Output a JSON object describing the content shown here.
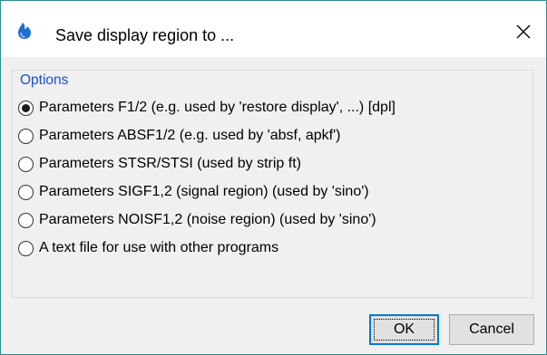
{
  "dialog": {
    "title": "Save display region to ...",
    "close_glyph": "✕",
    "icons": {
      "app": "topspin-drop-icon",
      "close": "close-icon"
    }
  },
  "options_group": {
    "title": "Options",
    "selected_index": 0,
    "items": [
      {
        "label": "Parameters F1/2 (e.g. used by 'restore display', ...) [dpl]"
      },
      {
        "label": "Parameters ABSF1/2 (e.g. used by 'absf, apkf')"
      },
      {
        "label": "Parameters STSR/STSI (used by strip ft)"
      },
      {
        "label": "Parameters SIGF1,2 (signal region) (used by 'sino')"
      },
      {
        "label": "Parameters NOISF1,2 (noise region) (used by 'sino')"
      },
      {
        "label": "A text file for use with other programs"
      }
    ]
  },
  "buttons": {
    "ok": {
      "accel": "O",
      "rest": "K"
    },
    "cancel": {
      "accel": "C",
      "rest": "ancel"
    }
  },
  "colors": {
    "accent": "#1a4fd6",
    "focus_border": "#0078d7",
    "window_border": "#2f8a8a"
  }
}
